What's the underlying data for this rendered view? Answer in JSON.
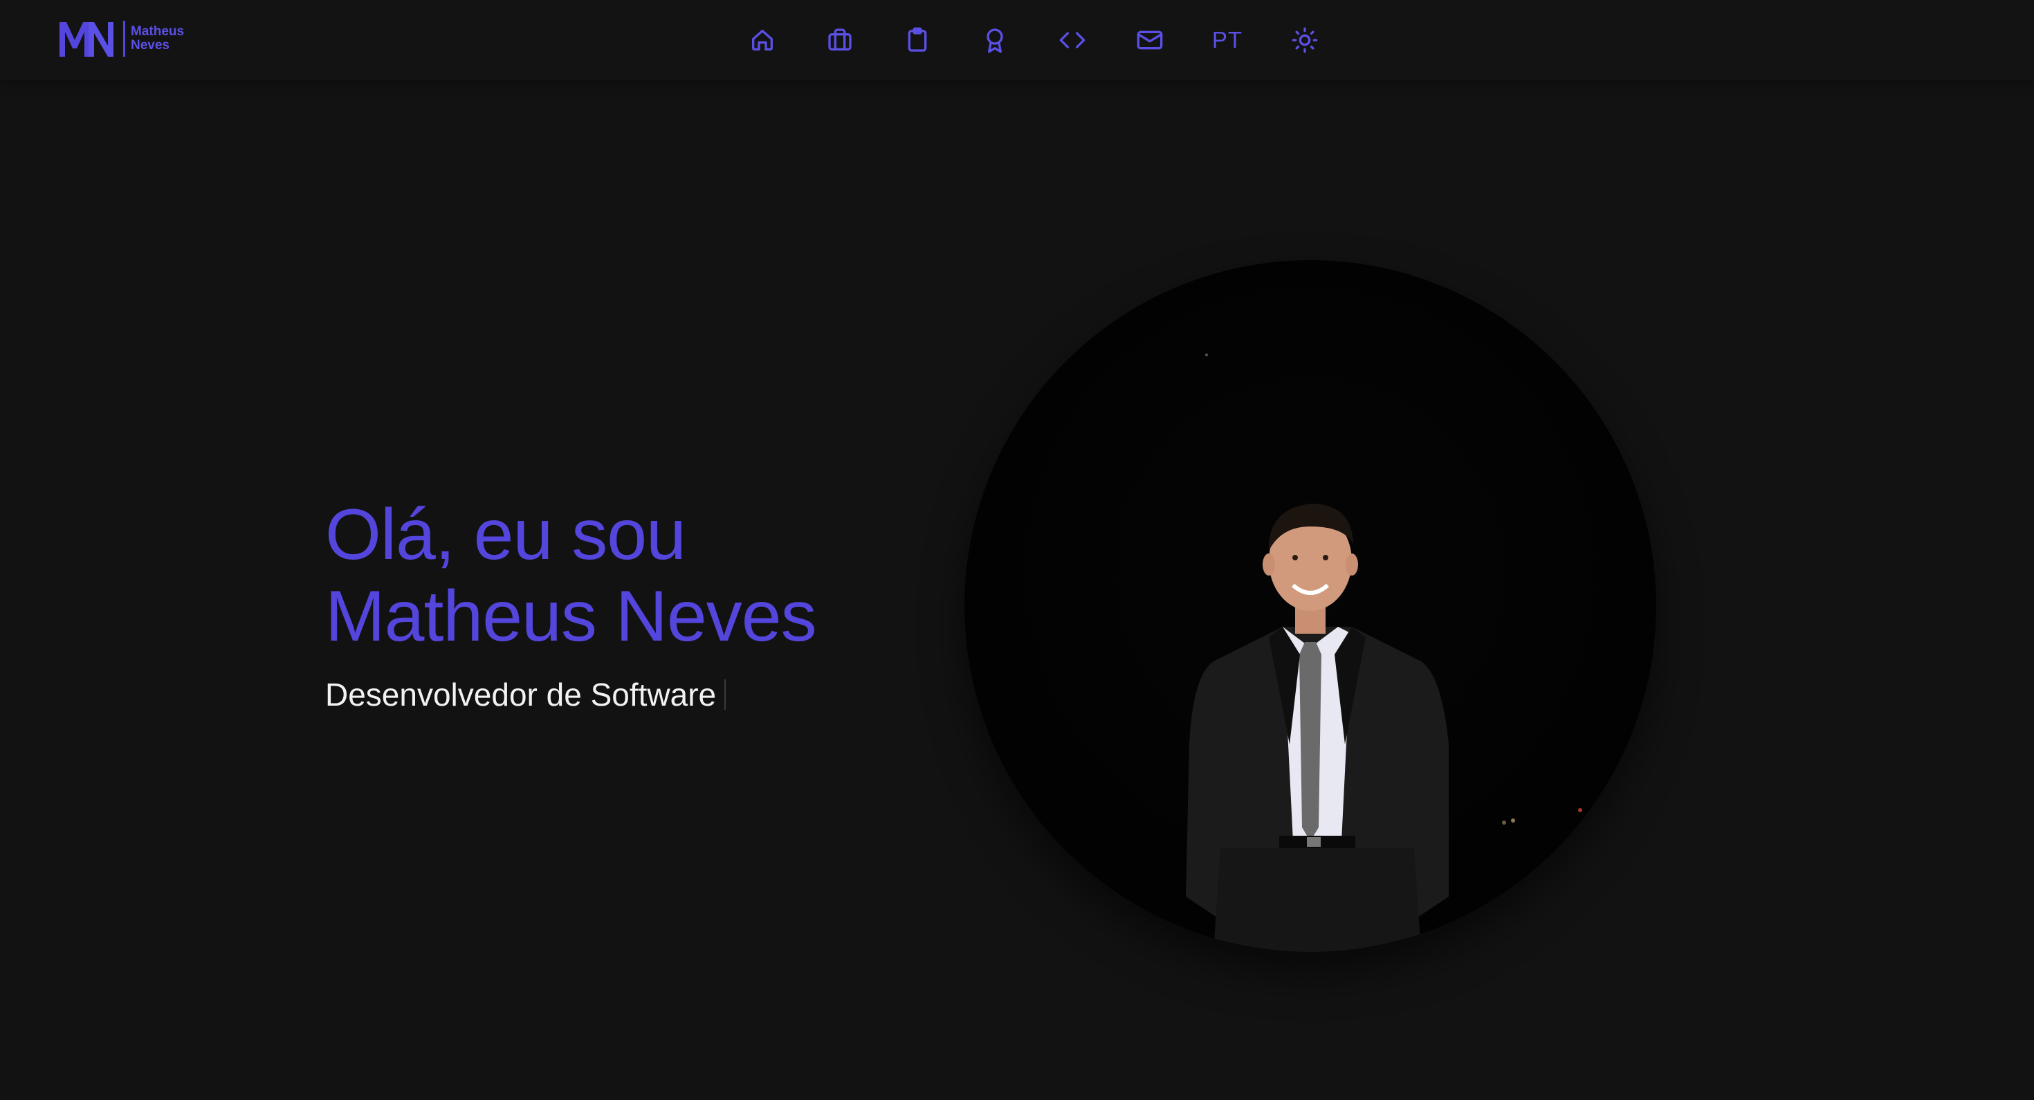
{
  "brand": {
    "logo_monogram": "MN",
    "name_line1": "Matheus",
    "name_line2": "Neves",
    "accent_color": "#5b50e6"
  },
  "nav": {
    "items": [
      {
        "name": "home",
        "icon": "home-icon"
      },
      {
        "name": "experience",
        "icon": "briefcase-icon"
      },
      {
        "name": "projects",
        "icon": "clipboard-icon"
      },
      {
        "name": "certificates",
        "icon": "award-icon"
      },
      {
        "name": "code",
        "icon": "code-icon"
      },
      {
        "name": "contact",
        "icon": "mail-icon"
      }
    ],
    "language": "PT",
    "theme_toggle_icon": "sun-icon"
  },
  "hero": {
    "greeting_line1": "Olá, eu sou",
    "greeting_line2": "Matheus Neves",
    "role": "Desenvolvedor de Software"
  },
  "colors": {
    "background": "#121212",
    "header": "#131313",
    "accent": "#5446dc",
    "text": "#f2f2f2"
  }
}
